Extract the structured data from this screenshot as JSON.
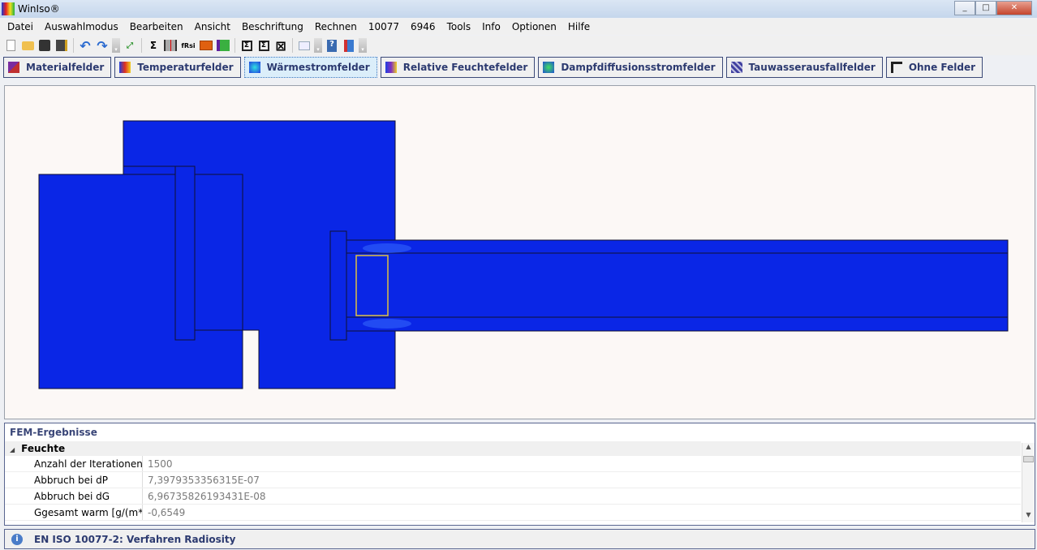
{
  "window": {
    "title": "WinIso®"
  },
  "menu": [
    "Datei",
    "Auswahlmodus",
    "Bearbeiten",
    "Ansicht",
    "Beschriftung",
    "Rechnen",
    "10077",
    "6946",
    "Tools",
    "Info",
    "Optionen",
    "Hilfe"
  ],
  "toolbar": {
    "sigma": "Σ",
    "frsi": "fRsi"
  },
  "fields": [
    {
      "label": "Materialfelder",
      "color": "#5a2ca0"
    },
    {
      "label": "Temperaturfelder",
      "color": "#e03020"
    },
    {
      "label": "Wärmestromfelder",
      "color": "#2040e0",
      "active": true
    },
    {
      "label": "Relative Feuchtefelder",
      "color": "#8030c0"
    },
    {
      "label": "Dampfdiffusionsstromfelder",
      "color": "#2050d0"
    },
    {
      "label": "Tauwasserausfallfelder",
      "color": "#4040a0"
    },
    {
      "label": "Ohne Felder",
      "color": "#202020"
    }
  ],
  "canvas": {
    "field_color": "#0a26e6"
  },
  "results": {
    "title": "FEM-Ergebnisse",
    "group": "Feuchte",
    "rows": [
      {
        "key": "Anzahl der Iterationen",
        "value": "1500"
      },
      {
        "key": "Abbruch bei dP",
        "value": "7,3979353356315E-07"
      },
      {
        "key": "Abbruch bei dG",
        "value": "6,96735826193431E-08"
      },
      {
        "key": "Ggesamt warm [g/(m*...",
        "value": "-0,6549"
      }
    ]
  },
  "status": {
    "text": "EN ISO 10077-2: Verfahren Radiosity"
  }
}
